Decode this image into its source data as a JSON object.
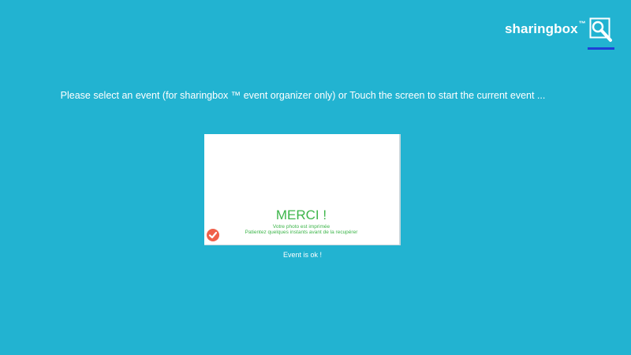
{
  "header": {
    "brand_name": "sharingbox",
    "brand_tm": "™",
    "settings_icon": "wrench-magnifier-icon"
  },
  "main": {
    "instructions": "Please select an event (for sharingbox ™ event organizer only) or Touch the screen to start the current event ..."
  },
  "event": {
    "title": "MERCI !",
    "line1": "Votre photo est imprimée",
    "line2": "Patientez quelques instants avant de la recupérer",
    "status_icon": "check-circle-icon",
    "status_text": "Event is ok !"
  },
  "colors": {
    "background": "#22b3d1",
    "merci_green": "#3db54a",
    "check_red": "#f0604b",
    "underline_blue": "#1f3fd6"
  }
}
